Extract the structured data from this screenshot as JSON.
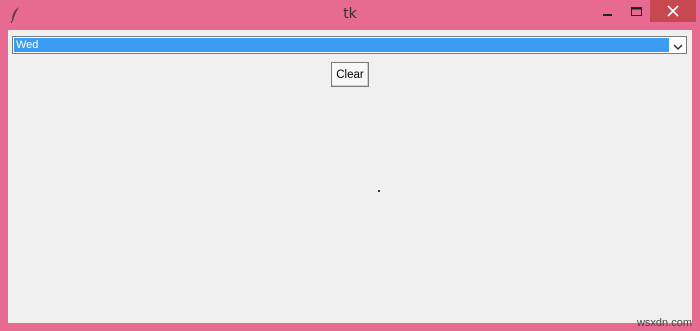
{
  "window": {
    "title": "tk",
    "colors": {
      "frame": "#e76a93",
      "close_button": "#c74850",
      "client_bg": "#f0f0f0",
      "selection": "#3b9cf4"
    }
  },
  "titlebar": {
    "app_icon": "feather-icon",
    "buttons": {
      "minimize_icon": "minimize-icon",
      "maximize_icon": "maximize-icon",
      "close_icon": "close-icon"
    }
  },
  "combobox": {
    "value": "Wed",
    "arrow_icon": "chevron-down-icon"
  },
  "clear_button": {
    "label": "Clear"
  },
  "result_label": {
    "text": ""
  },
  "watermark": {
    "text": "wsxdn.com"
  }
}
